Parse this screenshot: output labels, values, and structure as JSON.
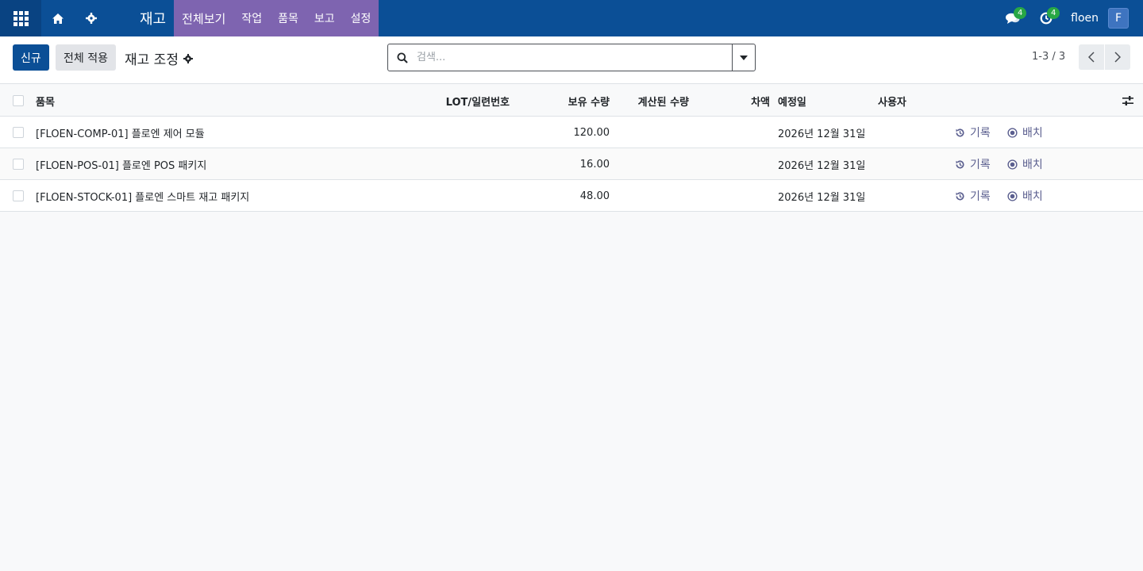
{
  "navbar": {
    "brand": "재고",
    "menus": [
      "전체보기",
      "작업",
      "품목",
      "보고",
      "설정"
    ],
    "messages_count": "4",
    "activities_count": "4",
    "user_name": "floen",
    "user_avatar": "F"
  },
  "control_panel": {
    "new_button": "신규",
    "apply_all_button": "전체 적용",
    "breadcrumb": "재고 조정",
    "search_placeholder": "검색...",
    "pager": "1-3 / 3"
  },
  "table": {
    "headers": {
      "product": "품목",
      "lot": "LOT/일련번호",
      "on_hand": "보유 수량",
      "counted": "계산된 수량",
      "difference": "차액",
      "scheduled_date": "예정일",
      "user": "사용자"
    },
    "rows": [
      {
        "product": "[FLOEN-COMP-01] 플로엔 제어 모듈",
        "on_hand": "120.00",
        "scheduled_date": "2026년 12월 31일",
        "history": "기록",
        "apply": "배치"
      },
      {
        "product": "[FLOEN-POS-01] 플로엔 POS 패키지",
        "on_hand": "16.00",
        "scheduled_date": "2026년 12월 31일",
        "history": "기록",
        "apply": "배치"
      },
      {
        "product": "[FLOEN-STOCK-01] 플로엔 스마트 재고 패키지",
        "on_hand": "48.00",
        "scheduled_date": "2026년 12월 31일",
        "history": "기록",
        "apply": "배치"
      }
    ]
  }
}
